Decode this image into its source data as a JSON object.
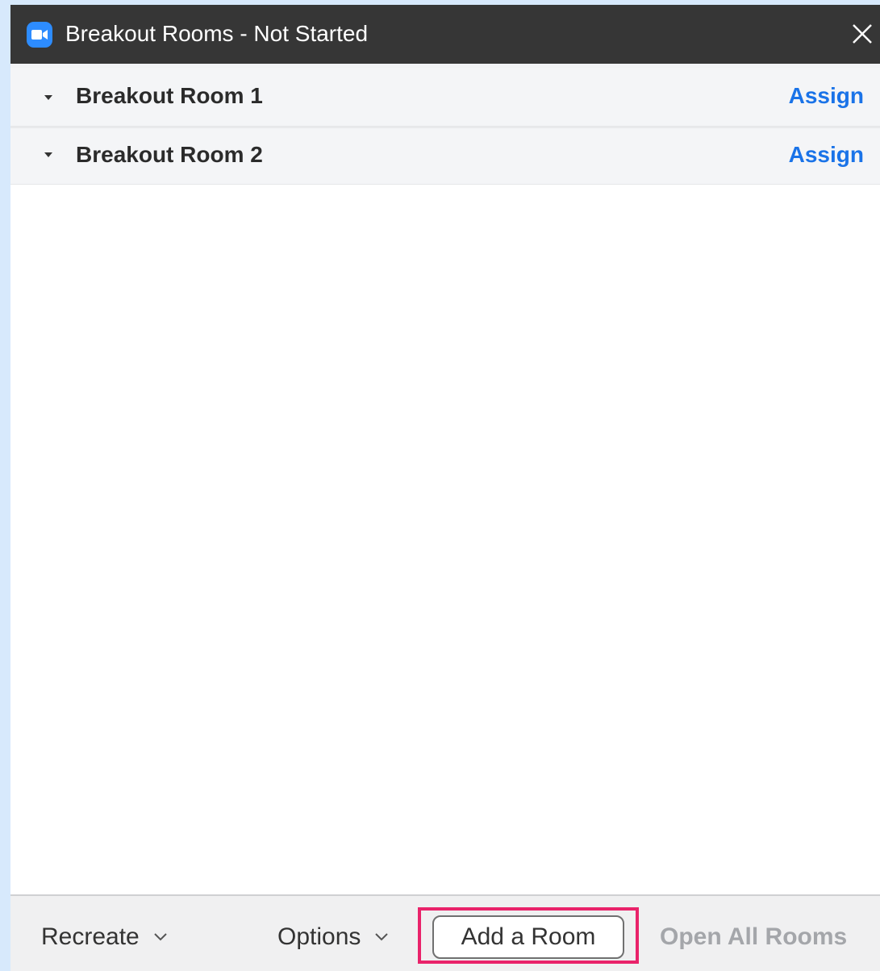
{
  "window": {
    "title": "Breakout Rooms - Not Started"
  },
  "rooms": [
    {
      "name": "Breakout Room 1",
      "action": "Assign"
    },
    {
      "name": "Breakout Room 2",
      "action": "Assign"
    }
  ],
  "footer": {
    "recreate_label": "Recreate",
    "options_label": "Options",
    "add_room_label": "Add a Room",
    "open_all_label": "Open All Rooms"
  },
  "colors": {
    "titlebar": "#363636",
    "accent_link": "#1a73e8",
    "highlight_border": "#e9236a",
    "disabled_text": "#a4a6aa",
    "app_icon": "#2d8cff"
  },
  "icons": {
    "app": "zoom-camera-icon",
    "close": "close-icon",
    "room_toggle": "caret-down-icon",
    "dropdown": "chevron-down-icon"
  }
}
